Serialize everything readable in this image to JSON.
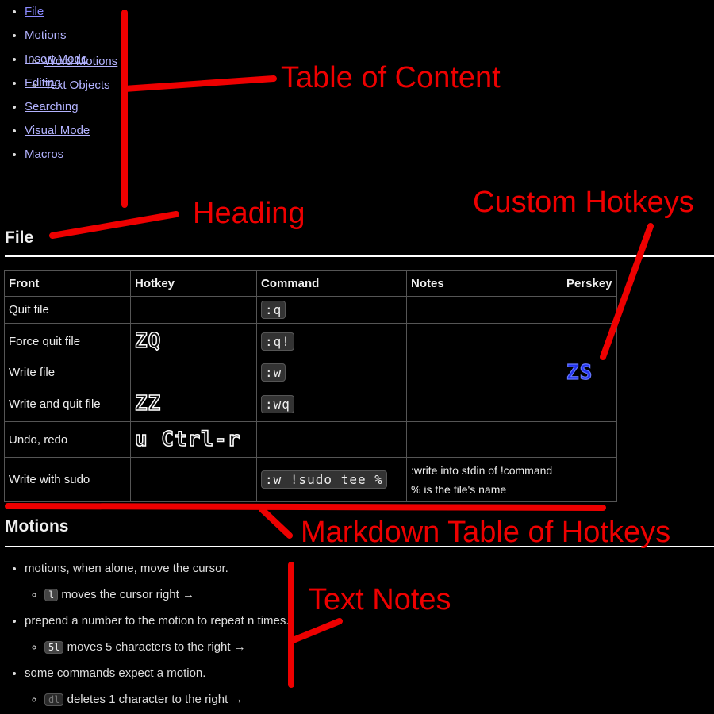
{
  "toc": {
    "items": [
      {
        "label": "File"
      },
      {
        "label": "Motions",
        "children": [
          {
            "label": "Word Motions"
          },
          {
            "label": "Text Objects"
          }
        ]
      },
      {
        "label": "Insert Mode"
      },
      {
        "label": "Editing"
      },
      {
        "label": "Searching"
      },
      {
        "label": "Visual Mode"
      },
      {
        "label": "Macros"
      }
    ]
  },
  "file_section": {
    "heading": "File",
    "table": {
      "headers": [
        "Front",
        "Hotkey",
        "Command",
        "Notes",
        "Perskey"
      ],
      "rows": [
        {
          "front": "Quit file",
          "hotkey": "",
          "command": ":q",
          "notes": [],
          "perskey": ""
        },
        {
          "front": "Force quit file",
          "hotkey": "ZQ",
          "command": ":q!",
          "notes": [],
          "perskey": ""
        },
        {
          "front": "Write file",
          "hotkey": "",
          "command": ":w",
          "notes": [],
          "perskey": "ZS"
        },
        {
          "front": "Write and quit file",
          "hotkey": "ZZ",
          "command": ":wq",
          "notes": [],
          "perskey": ""
        },
        {
          "front": "Undo, redo",
          "hotkey": "u Ctrl-r",
          "command": "",
          "notes": [],
          "perskey": ""
        },
        {
          "front": "Write with sudo",
          "hotkey": "",
          "command": ":w !sudo tee %",
          "notes": [
            ":write into stdin of !command",
            "% is the file's name"
          ],
          "perskey": ""
        }
      ]
    }
  },
  "motions_section": {
    "heading": "Motions",
    "bullets": [
      {
        "text": "motions, when alone, move the cursor.",
        "sub": {
          "code": "l",
          "text": "moves the cursor right →"
        }
      },
      {
        "text": "prepend a number to the motion to repeat n times.",
        "sub": {
          "code": "5l",
          "text": "moves 5 characters to the right →"
        }
      },
      {
        "text": "some commands expect a motion.",
        "sub": {
          "code": "dl",
          "text": "deletes 1 character to the right →"
        }
      }
    ]
  },
  "annotations": {
    "toc": "Table of Content",
    "heading": "Heading",
    "custom_hotkeys": "Custom Hotkeys",
    "markdown_table": "Markdown Table of Hotkeys",
    "text_notes": "Text Notes"
  },
  "colors": {
    "annotation": "#ee0000",
    "link": "#b3b3ff",
    "perskey": "#2233ee"
  }
}
